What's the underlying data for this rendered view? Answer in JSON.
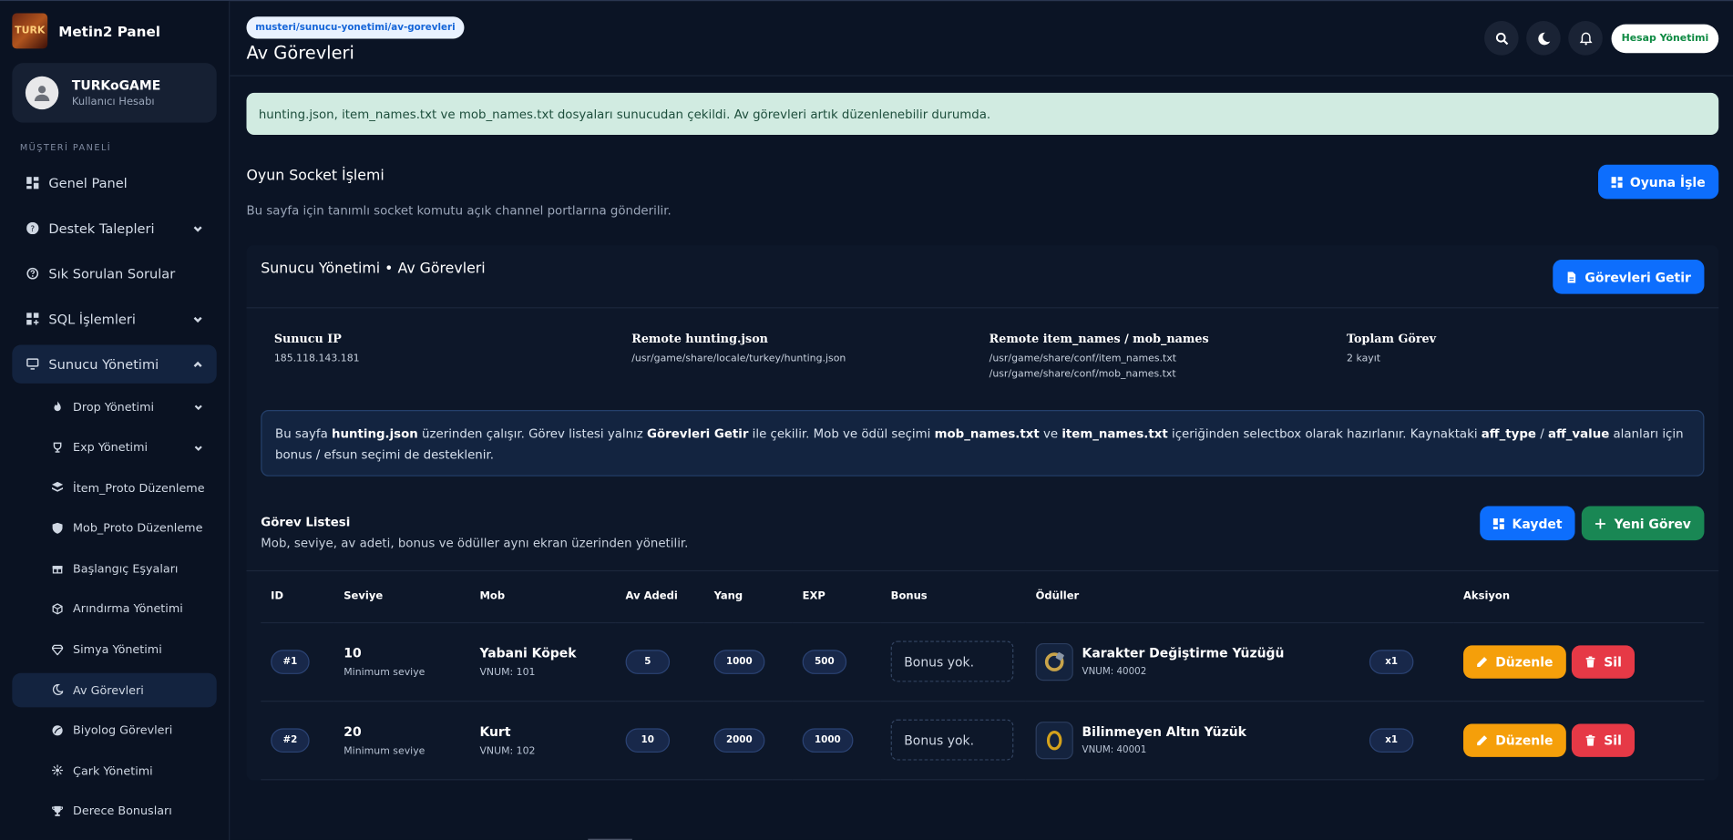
{
  "brand": {
    "logo_text": "TURK",
    "name": "Metin2 Panel"
  },
  "user": {
    "name": "TURKoGAME",
    "role": "Kullanıcı Hesabı"
  },
  "sidebar": {
    "section_label": "MÜŞTERİ PANELİ",
    "items": [
      {
        "label": "Genel Panel"
      },
      {
        "label": "Destek Talepleri"
      },
      {
        "label": "Sık Sorulan Sorular"
      },
      {
        "label": "SQL İşlemleri"
      },
      {
        "label": "Sunucu Yönetimi"
      }
    ],
    "sub_items": [
      {
        "label": "Drop Yönetimi"
      },
      {
        "label": "Exp Yönetimi"
      },
      {
        "label": "İtem_Proto Düzenleme"
      },
      {
        "label": "Mob_Proto Düzenleme"
      },
      {
        "label": "Başlangıç Eşyaları"
      },
      {
        "label": "Arındırma Yönetimi"
      },
      {
        "label": "Simya Yönetimi"
      },
      {
        "label": "Av Görevleri"
      },
      {
        "label": "Biyolog Görevleri"
      },
      {
        "label": "Çark Yönetimi"
      },
      {
        "label": "Derece Bonusları"
      }
    ]
  },
  "header": {
    "breadcrumb": "musteri/sunucu-yonetimi/av-gorevleri",
    "title": "Av Görevleri",
    "account_button": "Hesap Yönetimi"
  },
  "alert": {
    "text": "hunting.json, item_names.txt ve mob_names.txt dosyaları sunucudan çekildi. Av görevleri artık düzenlenebilir durumda."
  },
  "socket": {
    "title": "Oyun Socket İşlemi",
    "description": "Bu sayfa için tanımlı socket komutu açık channel portlarına gönderilir.",
    "button": "Oyuna İşle"
  },
  "panel": {
    "title": "Sunucu Yönetimi • Av Görevleri",
    "button": "Görevleri Getir",
    "info": [
      {
        "label": "Sunucu IP",
        "lines": [
          "185.118.143.181"
        ]
      },
      {
        "label": "Remote hunting.json",
        "lines": [
          "/usr/game/share/locale/turkey/hunting.json"
        ]
      },
      {
        "label": "Remote item_names / mob_names",
        "lines": [
          "/usr/game/share/conf/item_names.txt",
          "/usr/game/share/conf/mob_names.txt"
        ]
      },
      {
        "label": "Toplam Görev",
        "lines": [
          "2 kayıt"
        ]
      }
    ],
    "note": {
      "p1": "Bu sayfa ",
      "b1": "hunting.json",
      "p2": " üzerinden çalışır. Görev listesi yalnız ",
      "b2": "Görevleri Getir",
      "p3": " ile çekilir. Mob ve ödül seçimi ",
      "b3": "mob_names.txt",
      "p4": " ve ",
      "b4": "item_names.txt",
      "p5": " içeriğinden selectbox olarak hazırlanır. Kaynaktaki ",
      "b5": "aff_type",
      "p6": " / ",
      "b6": "aff_value",
      "p7": " alanları için bonus / efsun seçimi de desteklenir."
    }
  },
  "list": {
    "title": "Görev Listesi",
    "description": "Mob, seviye, av adeti, bonus ve ödüller aynı ekran üzerinden yönetilir.",
    "save_button": "Kaydet",
    "new_button": "Yeni Görev",
    "columns": [
      "ID",
      "Seviye",
      "Mob",
      "Av Adedi",
      "Yang",
      "EXP",
      "Bonus",
      "Ödüller",
      "Aksiyon"
    ],
    "rows": [
      {
        "id": "#1",
        "level": "10",
        "level_sub": "Minimum seviye",
        "mob": "Yabani Köpek",
        "mob_vnum": "VNUM: 101",
        "count": "5",
        "yang": "1000",
        "exp": "500",
        "bonus": "Bonus yok.",
        "reward_name": "Karakter Değiştirme Yüzüğü",
        "reward_vnum": "VNUM: 40002",
        "reward_qty": "x1",
        "edit": "Düzenle",
        "delete": "Sil"
      },
      {
        "id": "#2",
        "level": "20",
        "level_sub": "Minimum seviye",
        "mob": "Kurt",
        "mob_vnum": "VNUM: 102",
        "count": "10",
        "yang": "2000",
        "exp": "1000",
        "bonus": "Bonus yok.",
        "reward_name": "Bilinmeyen Altın Yüzük",
        "reward_vnum": "VNUM: 40001",
        "reward_qty": "x1",
        "edit": "Düzenle",
        "delete": "Sil"
      }
    ]
  }
}
